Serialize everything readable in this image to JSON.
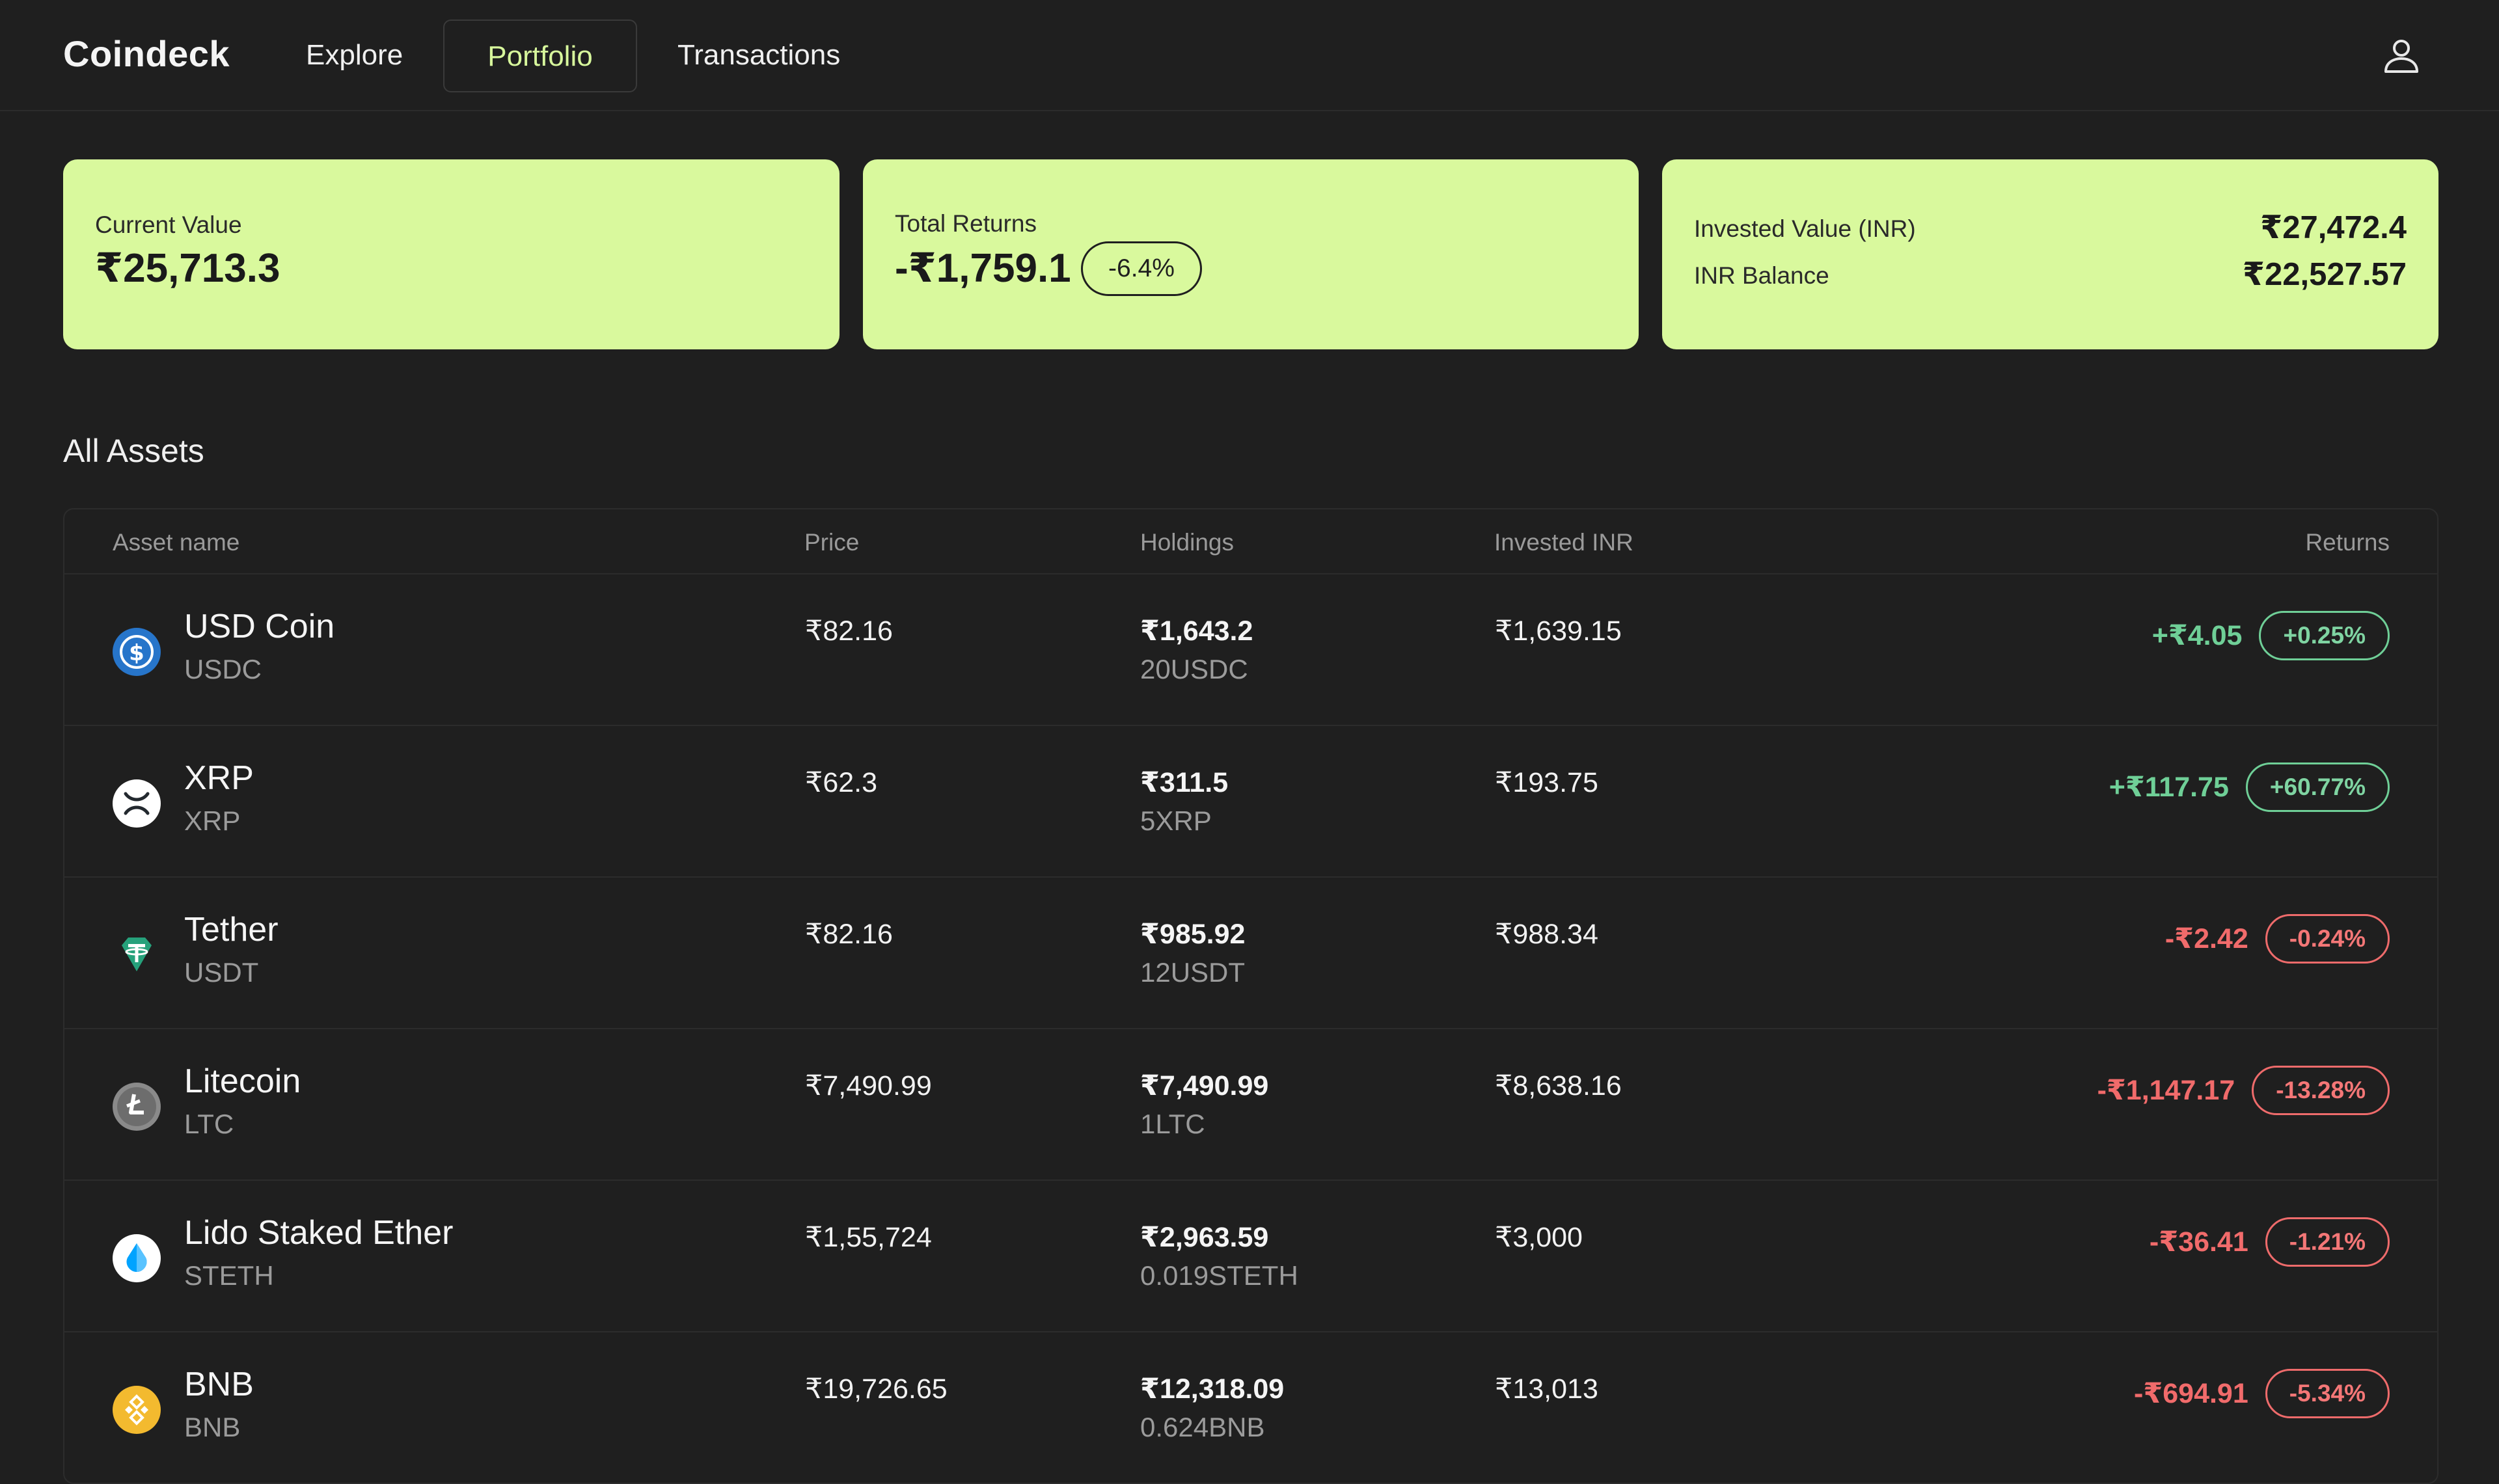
{
  "app": {
    "name": "Coindeck"
  },
  "nav": {
    "explore": "Explore",
    "portfolio": "Portfolio",
    "transactions": "Transactions",
    "active": "Portfolio"
  },
  "summary": {
    "current_value": {
      "label": "Current Value",
      "value": "₹25,713.3"
    },
    "total_returns": {
      "label": "Total Returns",
      "value": "-₹1,759.1",
      "percent": "-6.4%"
    },
    "invested": {
      "label": "Invested Value (INR)",
      "value": "₹27,472.4"
    },
    "inr_balance": {
      "label": "INR Balance",
      "value": "₹22,527.57"
    }
  },
  "assets_section": {
    "title": "All Assets",
    "columns": {
      "asset": "Asset name",
      "price": "Price",
      "holdings": "Holdings",
      "invested": "Invested INR",
      "returns": "Returns"
    },
    "rows": [
      {
        "name": "USD Coin",
        "symbol": "USDC",
        "icon": "usdc-icon",
        "price": "₹82.16",
        "holdings_value": "₹1,643.2",
        "holdings_qty": "20USDC",
        "invested": "₹1,639.15",
        "returns": "+₹4.05",
        "returns_pct": "+0.25%",
        "direction": "positive"
      },
      {
        "name": "XRP",
        "symbol": "XRP",
        "icon": "xrp-icon",
        "price": "₹62.3",
        "holdings_value": "₹311.5",
        "holdings_qty": "5XRP",
        "invested": "₹193.75",
        "returns": "+₹117.75",
        "returns_pct": "+60.77%",
        "direction": "positive"
      },
      {
        "name": "Tether",
        "symbol": "USDT",
        "icon": "tether-icon",
        "price": "₹82.16",
        "holdings_value": "₹985.92",
        "holdings_qty": "12USDT",
        "invested": "₹988.34",
        "returns": "-₹2.42",
        "returns_pct": "-0.24%",
        "direction": "negative"
      },
      {
        "name": "Litecoin",
        "symbol": "LTC",
        "icon": "litecoin-icon",
        "price": "₹7,490.99",
        "holdings_value": "₹7,490.99",
        "holdings_qty": "1LTC",
        "invested": "₹8,638.16",
        "returns": "-₹1,147.17",
        "returns_pct": "-13.28%",
        "direction": "negative"
      },
      {
        "name": "Lido Staked Ether",
        "symbol": "STETH",
        "icon": "lido-steth-icon",
        "price": "₹1,55,724",
        "holdings_value": "₹2,963.59",
        "holdings_qty": "0.019STETH",
        "invested": "₹3,000",
        "returns": "-₹36.41",
        "returns_pct": "-1.21%",
        "direction": "negative"
      },
      {
        "name": "BNB",
        "symbol": "BNB",
        "icon": "bnb-icon",
        "price": "₹19,726.65",
        "holdings_value": "₹12,318.09",
        "holdings_qty": "0.624BNB",
        "invested": "₹13,013",
        "returns": "-₹694.91",
        "returns_pct": "-5.34%",
        "direction": "negative"
      }
    ]
  },
  "colors": {
    "background": "#1f1f1f",
    "card": "#d9f99d",
    "accent": "#d7f79c",
    "positive": "#6fcf97",
    "negative": "#f16b6b"
  }
}
